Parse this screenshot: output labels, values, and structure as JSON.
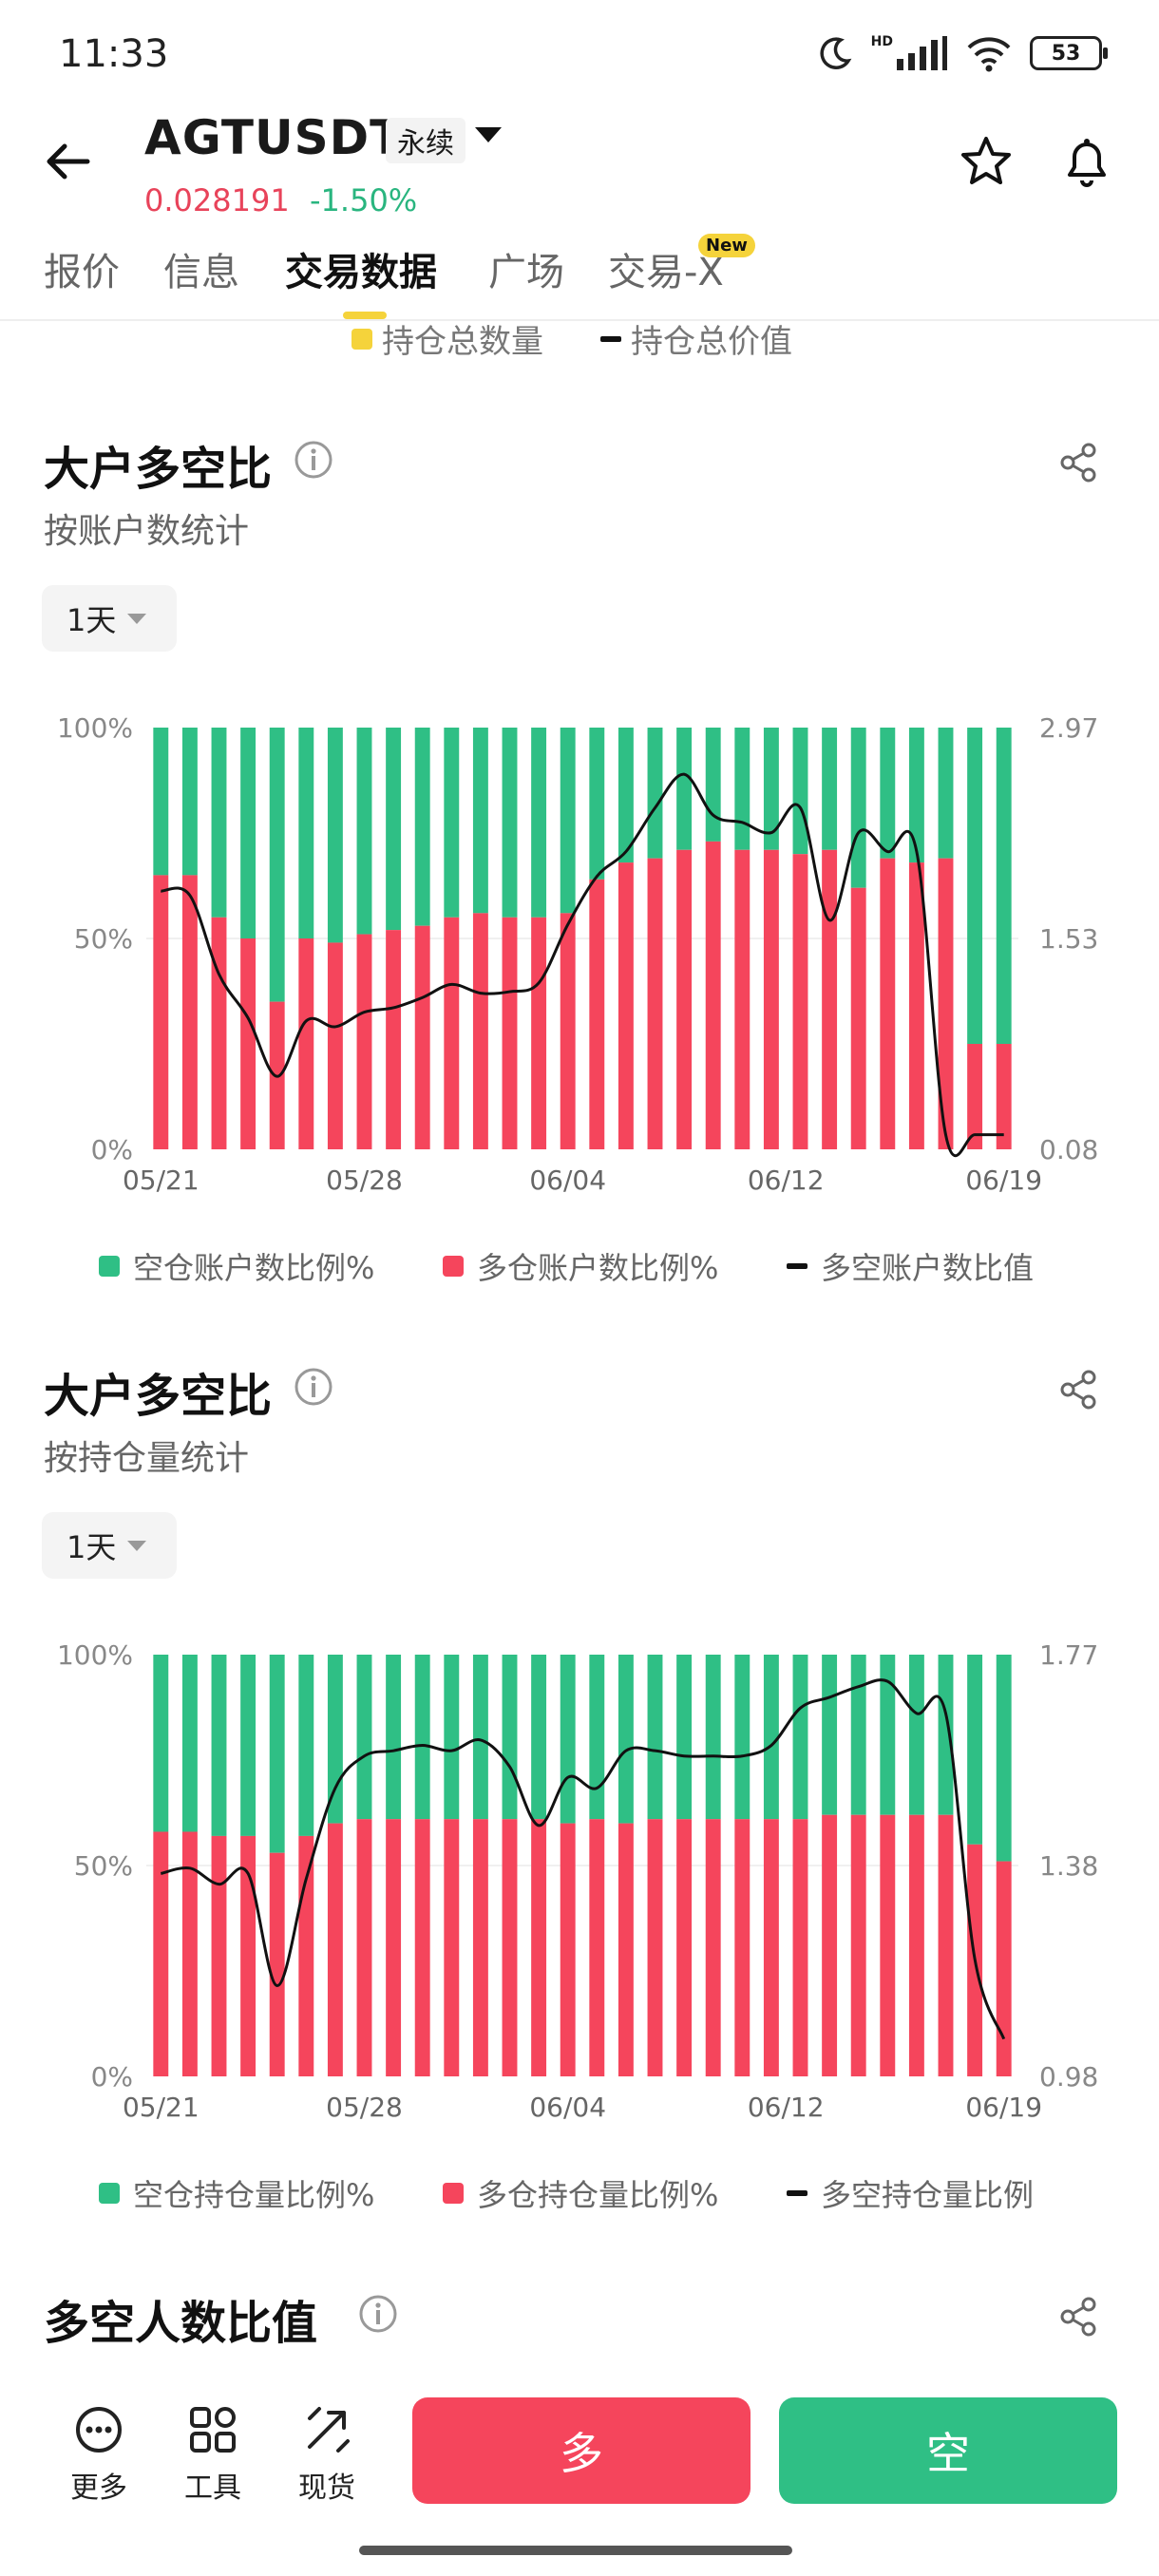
{
  "status": {
    "time": "11:33",
    "battery": "53",
    "network": "HD"
  },
  "header": {
    "symbol": "AGTUSDT",
    "contract_type": "永续",
    "price": "0.028191",
    "change": "-1.50%"
  },
  "tabs": [
    {
      "label": "报价",
      "active": false
    },
    {
      "label": "信息",
      "active": false
    },
    {
      "label": "交易数据",
      "active": true
    },
    {
      "label": "广场",
      "active": false
    },
    {
      "label": "交易-X",
      "active": false,
      "badge": "New"
    }
  ],
  "prev_legend": {
    "item1": "持仓总数量",
    "item2": "持仓总价值"
  },
  "sections": [
    {
      "title": "大户多空比",
      "subtitle": "按账户数统计",
      "period": "1天",
      "legend": {
        "short": "空仓账户数比例%",
        "long": "多仓账户数比例%",
        "ratio": "多空账户数比值"
      }
    },
    {
      "title": "大户多空比",
      "subtitle": "按持仓量统计",
      "period": "1天",
      "legend": {
        "short": "空仓持仓量比例%",
        "long": "多仓持仓量比例%",
        "ratio": "多空持仓量比例"
      }
    },
    {
      "title": "多空人数比值"
    }
  ],
  "chart_data": [
    {
      "type": "bar",
      "stacked": true,
      "x_ticks": [
        "05/21",
        "05/28",
        "06/04",
        "06/12",
        "06/19"
      ],
      "left_axis_ticks": [
        "100%",
        "50%",
        "0%"
      ],
      "right_axis_ticks": [
        "2.97",
        "1.53",
        "0.08"
      ],
      "ylim_left": [
        0,
        100
      ],
      "ylim_right": [
        0.08,
        2.97
      ],
      "colors": {
        "long": "#f5455c",
        "short": "#2fbf85",
        "ratio": "#111111"
      },
      "series": [
        {
          "name": "多仓账户数比例%",
          "values": [
            65,
            65,
            55,
            50,
            35,
            50,
            49,
            51,
            52,
            53,
            55,
            56,
            55,
            55,
            56,
            64,
            68,
            69,
            71,
            73,
            71,
            71,
            70,
            71,
            62,
            69,
            68,
            69,
            25,
            25
          ]
        },
        {
          "name": "空仓账户数比例%",
          "values": [
            35,
            35,
            45,
            50,
            65,
            50,
            51,
            49,
            48,
            47,
            45,
            44,
            45,
            45,
            44,
            36,
            32,
            31,
            29,
            27,
            29,
            29,
            30,
            29,
            38,
            31,
            32,
            31,
            75,
            75
          ]
        },
        {
          "name": "多空账户数比值",
          "values": [
            1.85,
            1.82,
            1.28,
            0.98,
            0.58,
            0.96,
            0.92,
            1.02,
            1.05,
            1.12,
            1.21,
            1.15,
            1.16,
            1.22,
            1.62,
            1.95,
            2.12,
            2.42,
            2.65,
            2.37,
            2.32,
            2.25,
            2.42,
            1.65,
            2.25,
            2.12,
            2.12,
            0.18,
            0.18,
            0.18
          ]
        }
      ]
    },
    {
      "type": "bar",
      "stacked": true,
      "x_ticks": [
        "05/21",
        "05/28",
        "06/04",
        "06/12",
        "06/19"
      ],
      "left_axis_ticks": [
        "100%",
        "50%",
        "0%"
      ],
      "right_axis_ticks": [
        "1.77",
        "1.38",
        "0.98"
      ],
      "ylim_left": [
        0,
        100
      ],
      "ylim_right": [
        0.98,
        1.77
      ],
      "colors": {
        "long": "#f5455c",
        "short": "#2fbf85",
        "ratio": "#111111"
      },
      "series": [
        {
          "name": "多仓持仓量比例%",
          "values": [
            58,
            58,
            57,
            57,
            53,
            57,
            60,
            61,
            61,
            61,
            61,
            61,
            61,
            61,
            60,
            61,
            60,
            61,
            61,
            61,
            61,
            61,
            61,
            62,
            62,
            62,
            62,
            62,
            55,
            51
          ]
        },
        {
          "name": "空仓持仓量比例%",
          "values": [
            42,
            42,
            43,
            43,
            47,
            43,
            40,
            39,
            39,
            39,
            39,
            39,
            39,
            39,
            40,
            39,
            40,
            39,
            39,
            39,
            39,
            39,
            39,
            38,
            38,
            38,
            38,
            38,
            45,
            49
          ]
        },
        {
          "name": "多空持仓量比例",
          "values": [
            1.36,
            1.37,
            1.34,
            1.36,
            1.15,
            1.35,
            1.52,
            1.58,
            1.59,
            1.6,
            1.59,
            1.61,
            1.56,
            1.45,
            1.54,
            1.52,
            1.59,
            1.59,
            1.58,
            1.58,
            1.58,
            1.6,
            1.67,
            1.69,
            1.71,
            1.72,
            1.66,
            1.66,
            1.2,
            1.05
          ]
        }
      ]
    }
  ],
  "bottom": {
    "more": "更多",
    "tools": "工具",
    "spot": "现货",
    "long": "多",
    "short": "空"
  }
}
